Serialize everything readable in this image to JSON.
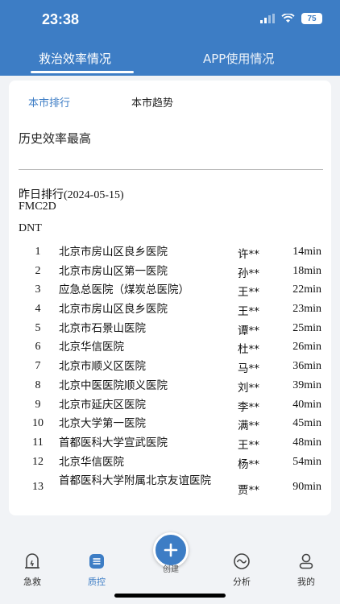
{
  "status_bar": {
    "time": "23:38",
    "battery": "75"
  },
  "top_tabs": [
    {
      "label": "救治效率情况",
      "active": true
    },
    {
      "label": "APP使用情况",
      "active": false
    }
  ],
  "sub_tabs": [
    {
      "label": "本市排行",
      "active": true
    },
    {
      "label": "本市趋势",
      "active": false
    }
  ],
  "card": {
    "title": "历史效率最高",
    "date_line": "昨日排行(2024-05-15)",
    "metric": "FMC2D",
    "metric2": "DNT"
  },
  "rankings": [
    {
      "rank": "1",
      "hospital": "北京市房山区良乡医院",
      "doctor": "许**",
      "time": "14min"
    },
    {
      "rank": "2",
      "hospital": "北京市房山区第一医院",
      "doctor": "孙**",
      "time": "18min"
    },
    {
      "rank": "3",
      "hospital": "应急总医院（煤炭总医院）",
      "doctor": "王**",
      "time": "22min"
    },
    {
      "rank": "4",
      "hospital": "北京市房山区良乡医院",
      "doctor": "王**",
      "time": "23min"
    },
    {
      "rank": "5",
      "hospital": "北京市石景山医院",
      "doctor": "谭**",
      "time": "25min"
    },
    {
      "rank": "6",
      "hospital": "北京华信医院",
      "doctor": "杜**",
      "time": "26min"
    },
    {
      "rank": "7",
      "hospital": "北京市顺义区医院",
      "doctor": "马**",
      "time": "36min"
    },
    {
      "rank": "8",
      "hospital": "北京中医医院顺义医院",
      "doctor": "刘**",
      "time": "39min"
    },
    {
      "rank": "9",
      "hospital": "北京市延庆区医院",
      "doctor": "李**",
      "time": "40min"
    },
    {
      "rank": "10",
      "hospital": "北京大学第一医院",
      "doctor": "满**",
      "time": "45min"
    },
    {
      "rank": "11",
      "hospital": "首都医科大学宣武医院",
      "doctor": "王**",
      "time": "48min"
    },
    {
      "rank": "12",
      "hospital": "北京华信医院",
      "doctor": "杨**",
      "time": "54min"
    },
    {
      "rank": "13",
      "hospital": "首都医科大学附属北京友谊医院",
      "doctor": "贾**",
      "time": "90min"
    }
  ],
  "bottom_nav": {
    "items": [
      {
        "label": "急救",
        "icon": "ambulance-icon",
        "active": false
      },
      {
        "label": "质控",
        "icon": "list-icon",
        "active": true
      },
      {
        "label": "分析",
        "icon": "chart-wave-icon",
        "active": false
      },
      {
        "label": "我的",
        "icon": "user-icon",
        "active": false
      }
    ],
    "create_label": "创建"
  },
  "colors": {
    "primary": "#3d7dc5",
    "background": "#f1f3f6"
  }
}
